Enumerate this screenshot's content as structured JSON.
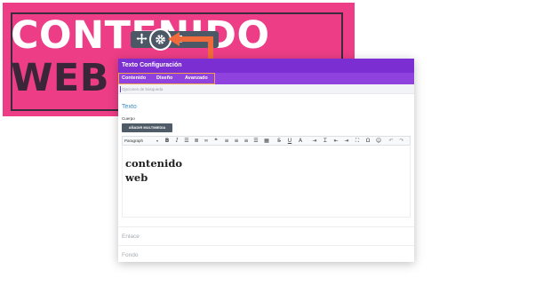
{
  "hero": {
    "line1": "CONTENIDO",
    "line2": "WEB",
    "background_color": "#ec3d86"
  },
  "module_toolbar": {
    "icons": [
      "move-icon",
      "gear-icon",
      "menu-icon"
    ]
  },
  "annotation": {
    "arrow_color": "#f06b3b"
  },
  "settings_panel": {
    "title": "Texto Configuración",
    "tabs": [
      {
        "label": "Contenido"
      },
      {
        "label": "Diseño"
      },
      {
        "label": "Avanzado"
      }
    ],
    "search_placeholder": "Opciones de búsqueda",
    "section_title": "Texto",
    "body_label": "Cuerpo",
    "add_media_label": "AÑADIR MULTIMEDIA",
    "editor": {
      "format_select": "Paragraph",
      "content": "contenido\nweb",
      "toolbar_icons": [
        "bold-icon",
        "italic-icon",
        "bullet-list-icon",
        "numbered-list-icon",
        "link-icon",
        "quote-icon",
        "align-left-icon",
        "align-center-icon",
        "align-right-icon",
        "justify-icon",
        "table-icon",
        "strikethrough-icon",
        "underline-icon",
        "text-color-icon",
        "indent-icon",
        "clear-format-icon",
        "outdent-icon",
        "indent-more-icon",
        "fullscreen-icon",
        "special-char-icon",
        "emoji-icon",
        "undo-icon",
        "redo-icon"
      ]
    },
    "link_label": "Enlace",
    "background_label": "Fondo",
    "accent_color": "#7b2fd3"
  }
}
